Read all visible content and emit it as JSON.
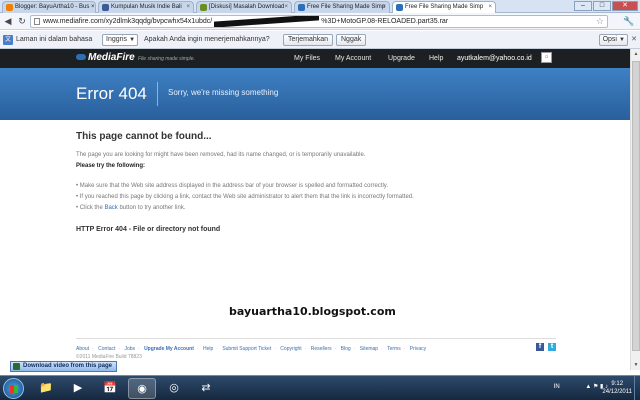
{
  "browser": {
    "tabs": [
      {
        "label": "Blogger: BayuArtha10 - Bus ×",
        "active": false,
        "favicon_color": "#f57d00"
      },
      {
        "label": "Kumpulan Musik Indie Bali",
        "active": false,
        "favicon_color": "#3b5998"
      },
      {
        "label": "[Diskusi] Masalah Download",
        "active": false,
        "favicon_color": "#6b8e23"
      },
      {
        "label": "Free File Sharing Made Simp",
        "active": false,
        "favicon_color": "#2d6fb6"
      },
      {
        "label": "Free File Sharing Made Simp",
        "active": true,
        "favicon_color": "#2d6fb6"
      }
    ],
    "tab_close_glyph": "×",
    "window_buttons": {
      "minimize": "–",
      "maximize": "□",
      "close": "✕"
    },
    "nav": {
      "back": "◀",
      "forward": "▶",
      "reload": "↻"
    },
    "url_before": "www.mediafire.com/xy2dlmk3qqdg/bvpcwhx54x1ubdc/",
    "url_after": "%3D+MotoGP.08-RELOADED.part35.rar",
    "star_glyph": "☆",
    "wrench_glyph": "🔧"
  },
  "translate_bar": {
    "icon": "文",
    "text1": "Laman ini dalam bahasa",
    "language": "Inggris",
    "text2": "Apakah Anda ingin menerjemahkannya?",
    "translate_button": "Terjemahkan",
    "no_button": "Nggak",
    "options": "Opsi",
    "close": "✕"
  },
  "mediafire": {
    "logo": "MediaFire",
    "tagline": "File sharing made simple.",
    "nav": [
      "My Files",
      "My Account",
      "Upgrade",
      "Help"
    ],
    "user_email": "ayutkalem@yahoo.co.id",
    "avatar": "⌂"
  },
  "error": {
    "title": "Error 404",
    "subtitle": "Sorry, we're missing something",
    "heading": "This page cannot be found...",
    "intro": "The page you are looking for might have been removed, had its name changed, or is temporarily unavailable.",
    "try_label": "Please try the following:",
    "tips": [
      "• Make sure that the Web site address displayed in the address bar of your browser is spelled and formatted correctly.",
      "• If you reached this page by clicking a link, contact the Web site administrator to alert them that the link is incorrectly formatted."
    ],
    "back_prefix": "• Click the ",
    "back_link": "Back",
    "back_suffix": " button to try another link.",
    "code": "HTTP Error 404 - File or directory not found"
  },
  "watermark": "bayuartha10.blogspot.com",
  "footer": {
    "links": [
      "About",
      "Contact",
      "Jobs",
      "Upgrade My Account",
      "Help",
      "Submit Support Ticket",
      "Copyright",
      "Resellers",
      "Blog",
      "Sitemap",
      "Terms",
      "Privacy"
    ],
    "copyright": "©2011 MediaFire Build 78823",
    "social": {
      "facebook": "f",
      "twitter": "t"
    }
  },
  "download_bar": {
    "label": "Download video from this page"
  },
  "taskbar": {
    "apps": [
      {
        "name": "explorer",
        "glyph": "📁"
      },
      {
        "name": "media",
        "glyph": "▶"
      },
      {
        "name": "calendar",
        "glyph": "📅"
      },
      {
        "name": "chrome",
        "glyph": "◉"
      },
      {
        "name": "firefox",
        "glyph": "◎"
      },
      {
        "name": "network",
        "glyph": "⇄"
      }
    ],
    "language": "IN",
    "tray_icons": "▲ ⚑ ▮ ♪",
    "time": "9:12",
    "date": "24/12/2011"
  }
}
